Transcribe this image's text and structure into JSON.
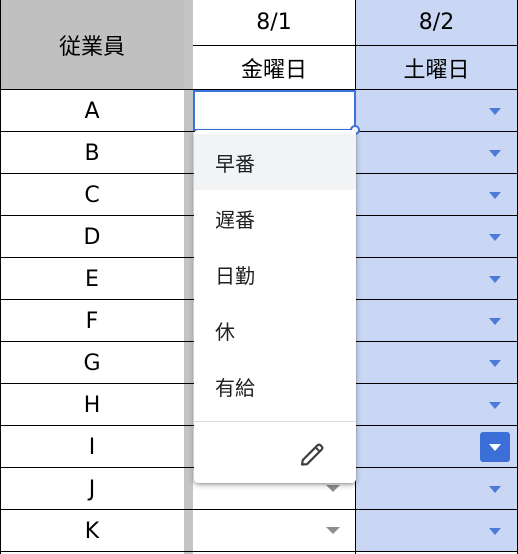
{
  "header": {
    "employee_label": "従業員",
    "col1": {
      "date": "8/1",
      "weekday": "金曜日"
    },
    "col2": {
      "date": "8/2",
      "weekday": "土曜日"
    }
  },
  "rows": [
    {
      "employee": "A"
    },
    {
      "employee": "B"
    },
    {
      "employee": "C"
    },
    {
      "employee": "D"
    },
    {
      "employee": "E"
    },
    {
      "employee": "F"
    },
    {
      "employee": "G"
    },
    {
      "employee": "H"
    },
    {
      "employee": "I"
    },
    {
      "employee": "J"
    },
    {
      "employee": "K"
    }
  ],
  "active_cell": {
    "value": ""
  },
  "dropdown": {
    "options": [
      "早番",
      "遅番",
      "日勤",
      "休",
      "有給"
    ],
    "highlighted_index": 0,
    "edit_icon": "pencil-icon"
  },
  "colors": {
    "header_gray": "#c0c0c0",
    "saturday_blue": "#c9d7f4",
    "accent_blue": "#3b73d8",
    "frozen_divider": "#c4c4c4"
  }
}
